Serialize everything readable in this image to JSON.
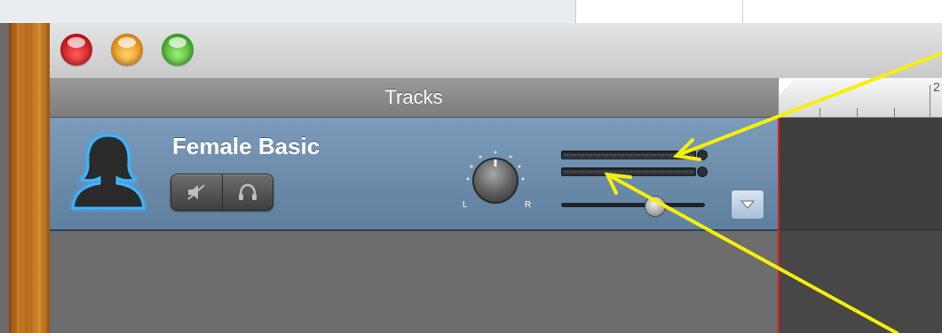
{
  "app": {
    "window_controls": [
      "close",
      "minimize",
      "zoom"
    ]
  },
  "tracks_header": {
    "title": "Tracks"
  },
  "ruler": {
    "label": "2"
  },
  "track": {
    "name": "Female Basic",
    "icon": "female-avatar-icon",
    "buttons": [
      {
        "name": "mute-button",
        "icon": "speaker-muted-icon"
      },
      {
        "name": "solo-button",
        "icon": "headphones-icon"
      }
    ],
    "pan_knob": {
      "left_label": "L",
      "right_label": "R"
    },
    "volume_level": 0.67,
    "expand_icon": "triangle-down-icon"
  },
  "annotations": {
    "arrow_color": "#f5f00a"
  },
  "colors": {
    "track_row": "#7090b0",
    "playhead": "#d62018",
    "avatar_glow": "#2aa8ff"
  }
}
